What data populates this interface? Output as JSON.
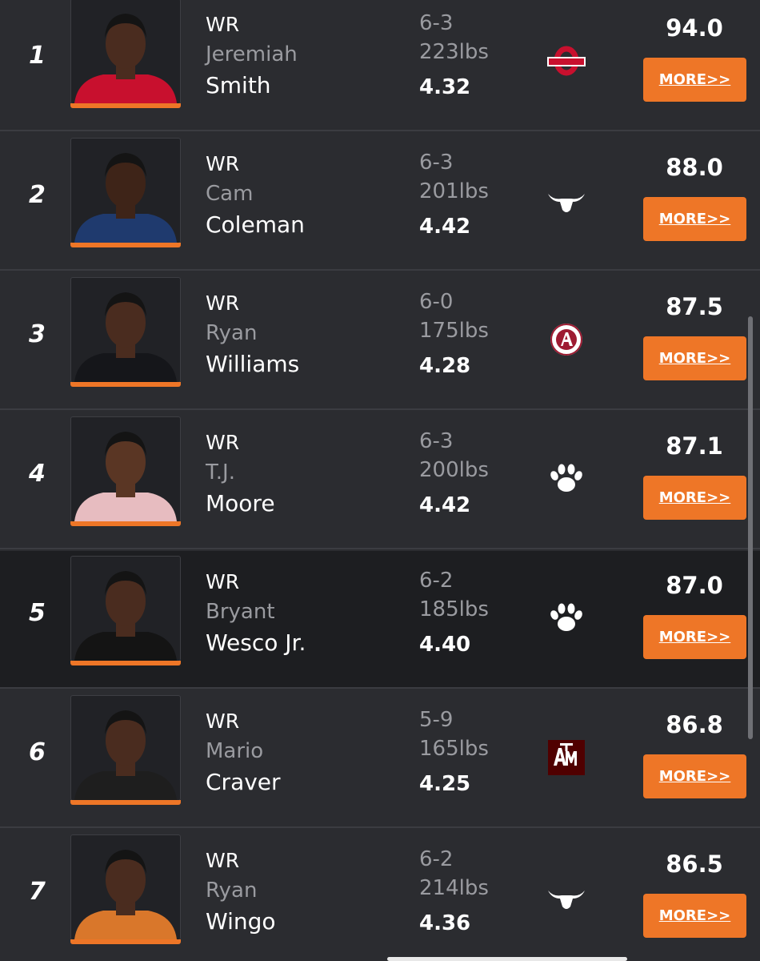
{
  "players": [
    {
      "rank": "1",
      "position": "WR",
      "first_name": "Jeremiah",
      "last_name": "Smith",
      "height": "6-3",
      "weight": "223lbs",
      "forty": "4.32",
      "school_icon": "ohio-state-logo",
      "rating": "94.0",
      "more_label": "MORE>>",
      "jersey_color": "#c8102e",
      "skin": "#4a2c1f"
    },
    {
      "rank": "2",
      "position": "WR",
      "first_name": "Cam",
      "last_name": "Coleman",
      "height": "6-3",
      "weight": "201lbs",
      "forty": "4.42",
      "school_icon": "texas-longhorn-logo",
      "rating": "88.0",
      "more_label": "MORE>>",
      "jersey_color": "#1f3a6e",
      "skin": "#3e2418"
    },
    {
      "rank": "3",
      "position": "WR",
      "first_name": "Ryan",
      "last_name": "Williams",
      "height": "6-0",
      "weight": "175lbs",
      "forty": "4.28",
      "school_icon": "alabama-logo",
      "rating": "87.5",
      "more_label": "MORE>>",
      "jersey_color": "#15161a",
      "skin": "#4a2c1f"
    },
    {
      "rank": "4",
      "position": "WR",
      "first_name": "T.J.",
      "last_name": "Moore",
      "height": "6-3",
      "weight": "200lbs",
      "forty": "4.42",
      "school_icon": "clemson-paw-logo",
      "rating": "87.1",
      "more_label": "MORE>>",
      "jersey_color": "#e7bcc0",
      "skin": "#5a3624"
    },
    {
      "rank": "5",
      "position": "WR",
      "first_name": "Bryant",
      "last_name": "Wesco Jr.",
      "height": "6-2",
      "weight": "185lbs",
      "forty": "4.40",
      "school_icon": "clemson-paw-logo",
      "rating": "87.0",
      "more_label": "MORE>>",
      "jersey_color": "#141414",
      "skin": "#4a2c1f"
    },
    {
      "rank": "6",
      "position": "WR",
      "first_name": "Mario",
      "last_name": "Craver",
      "height": "5-9",
      "weight": "165lbs",
      "forty": "4.25",
      "school_icon": "texas-am-logo",
      "rating": "86.8",
      "more_label": "MORE>>",
      "jersey_color": "#1e1e1e",
      "skin": "#4a2c1f"
    },
    {
      "rank": "7",
      "position": "WR",
      "first_name": "Ryan",
      "last_name": "Wingo",
      "height": "6-2",
      "weight": "214lbs",
      "forty": "4.36",
      "school_icon": "texas-longhorn-logo",
      "rating": "86.5",
      "more_label": "MORE>>",
      "jersey_color": "#d9772b",
      "skin": "#4a2c1f"
    }
  ],
  "colors": {
    "accent": "#ee7627",
    "background": "#2b2c30",
    "highlight_row": "#1d1e21",
    "muted_text": "#9a9ba0",
    "ohio_state_red": "#c8102e",
    "alabama_crimson": "#9e1b32",
    "texas_am_maroon": "#500000"
  }
}
